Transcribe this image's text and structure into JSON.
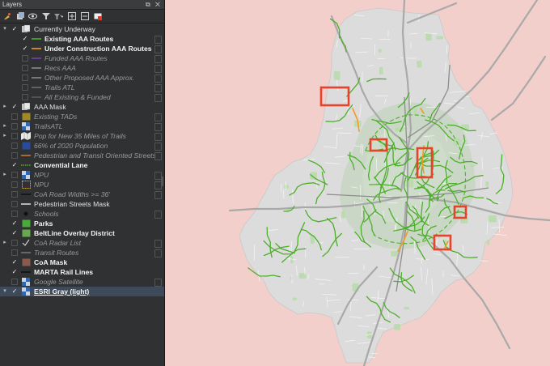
{
  "panel": {
    "title": "Layers",
    "window_controls": "⧉ ✕"
  },
  "toolbar": {
    "icons": [
      "open-layer-styling-icon",
      "add-group-icon",
      "manage-visibility-icon",
      "filter-legend-icon",
      "filter-by-expression-icon",
      "expand-all-icon",
      "collapse-all-icon",
      "remove-layer-icon"
    ]
  },
  "layers": [
    {
      "label": "Currently Underway",
      "style": "norm",
      "checked": true,
      "expand": "open",
      "indent": 0,
      "symbol": "group"
    },
    {
      "label": "Existing AAA Routes",
      "style": "bold",
      "checked": true,
      "expand": "none",
      "indent": 1,
      "symbol": "line",
      "color": "#4caf2a"
    },
    {
      "label": "Under Construction AAA Routes",
      "style": "bold",
      "checked": true,
      "expand": "none",
      "indent": 1,
      "symbol": "line",
      "color": "#f29b26"
    },
    {
      "label": "Funded AAA Routes",
      "style": "ital",
      "checked": false,
      "expand": "none",
      "indent": 1,
      "symbol": "line",
      "color": "#7a3fb0"
    },
    {
      "label": "Recs AAA",
      "style": "ital",
      "checked": false,
      "expand": "none",
      "indent": 1,
      "symbol": "line",
      "color": "#8a8a8a"
    },
    {
      "label": "Other Proposed AAA Approx.",
      "style": "ital",
      "checked": false,
      "expand": "none",
      "indent": 1,
      "symbol": "line",
      "color": "#8a8a8a"
    },
    {
      "label": "Trails ATL",
      "style": "ital",
      "checked": false,
      "expand": "none",
      "indent": 1,
      "symbol": "line",
      "color": "#6e6e6e"
    },
    {
      "label": "All Existing & Funded",
      "style": "ital",
      "checked": false,
      "expand": "none",
      "indent": 1,
      "symbol": "line",
      "color": "#5a5a5a"
    },
    {
      "label": "AAA Mask",
      "style": "norm",
      "checked": true,
      "expand": "closed",
      "indent": 0,
      "symbol": "group"
    },
    {
      "label": "Existing TADs",
      "style": "ital",
      "checked": false,
      "expand": "none",
      "indent": 0,
      "symbol": "fill",
      "color": "#a08a28"
    },
    {
      "label": "TrailsATL",
      "style": "ital",
      "checked": false,
      "expand": "closed",
      "indent": 0,
      "symbol": "checker"
    },
    {
      "label": "Pop for New 35 Miles of Trails",
      "style": "ital",
      "checked": false,
      "expand": "closed",
      "indent": 0,
      "symbol": "map"
    },
    {
      "label": "66% of 2020 Population",
      "style": "ital",
      "checked": false,
      "expand": "none",
      "indent": 0,
      "symbol": "fill",
      "color": "#2a4a9a"
    },
    {
      "label": "Pedestrian and Transit Oriented Streets",
      "style": "ital",
      "checked": false,
      "expand": "none",
      "indent": 0,
      "symbol": "line",
      "color": "#c07a3a"
    },
    {
      "label": "Convential Lane",
      "style": "bold",
      "checked": true,
      "expand": "none",
      "indent": 0,
      "symbol": "dotline",
      "color": "#4caf2a"
    },
    {
      "label": "NPU",
      "style": "ital",
      "checked": false,
      "expand": "closed",
      "indent": 0,
      "symbol": "checker"
    },
    {
      "label": "NPU",
      "style": "ital",
      "checked": false,
      "expand": "none",
      "indent": 0,
      "symbol": "dashbox",
      "color": "#e6a020"
    },
    {
      "label": "CoA Road Widths >= 36'",
      "style": "ital",
      "checked": false,
      "expand": "none",
      "indent": 0,
      "symbol": "line",
      "color": "#111111"
    },
    {
      "label": "Pedestrian Streets Mask",
      "style": "norm",
      "checked": false,
      "expand": "none",
      "indent": 0,
      "symbol": "line",
      "color": "#d8d8d8"
    },
    {
      "label": "Schools",
      "style": "ital",
      "checked": false,
      "expand": "none",
      "indent": 0,
      "symbol": "dot",
      "color": "#111111"
    },
    {
      "label": "Parks",
      "style": "bold",
      "checked": true,
      "expand": "none",
      "indent": 0,
      "symbol": "fill",
      "color": "#4ca83a"
    },
    {
      "label": "BeltLine Overlay District",
      "style": "bold",
      "checked": true,
      "expand": "none",
      "indent": 0,
      "symbol": "fill",
      "color": "#6aa84f"
    },
    {
      "label": "CoA Radar List",
      "style": "ital",
      "checked": false,
      "expand": "closed",
      "indent": 0,
      "symbol": "check"
    },
    {
      "label": "Transit Routes",
      "style": "ital",
      "checked": false,
      "expand": "none",
      "indent": 0,
      "symbol": "line",
      "color": "#777777"
    },
    {
      "label": "CoA Mask",
      "style": "bold",
      "checked": true,
      "expand": "none",
      "indent": 0,
      "symbol": "fill",
      "color": "#8a5a4e"
    },
    {
      "label": "MARTA Rail Lines",
      "style": "bold",
      "checked": true,
      "expand": "none",
      "indent": 0,
      "symbol": "line",
      "color": "#111111"
    },
    {
      "label": "Google Satellite",
      "style": "ital",
      "checked": false,
      "expand": "none",
      "indent": 0,
      "symbol": "checker"
    },
    {
      "label": "ESRI Gray (light)",
      "style": "under",
      "checked": true,
      "expand": "open",
      "indent": 0,
      "symbol": "checker",
      "selected": true
    }
  ],
  "colors": {
    "outside_mask": "#f2cfcb",
    "city_fill": "#d9d9d9",
    "beltline": "#c7d4c2",
    "park": "#b7dba8",
    "existing_route": "#4caf2a",
    "construction_route": "#f29b26",
    "highlight_box": "#e8432a",
    "highway": "#a7a7a7",
    "rail": "#8c8c8c"
  },
  "map": {
    "highlight_areas": 5
  }
}
